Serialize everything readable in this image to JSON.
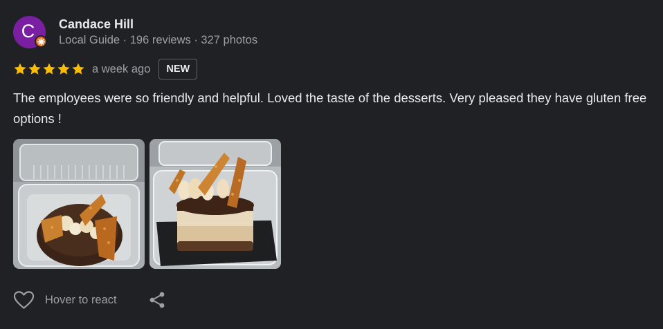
{
  "reviewer": {
    "initial": "C",
    "name": "Candace Hill",
    "meta": "Local Guide · 196 reviews · 327 photos",
    "avatar_color": "#7b1fa2",
    "badge_icon": "local-guide-star-icon"
  },
  "rating": {
    "stars": 5,
    "max_stars": 5,
    "star_color": "#fbbc04",
    "date": "a week ago",
    "badge": "NEW"
  },
  "review_text": "The employees were so friendly and helpful. Loved the taste of the desserts. Very pleased they have gluten free options !",
  "photos": [
    {
      "subject": "dessert-cup-top-view"
    },
    {
      "subject": "dessert-cup-side-view"
    }
  ],
  "actions": {
    "react_icon": "heart-outline-icon",
    "react_label": "Hover to react",
    "share_icon": "share-icon"
  }
}
